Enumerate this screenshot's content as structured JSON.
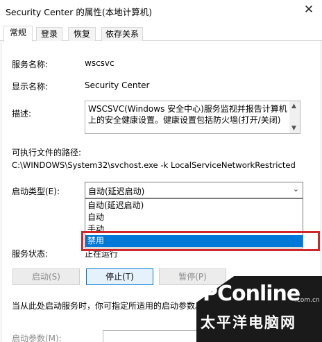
{
  "window": {
    "title": "Security Center 的属性(本地计算机)",
    "close_glyph": "✕"
  },
  "tabs": [
    "常规",
    "登录",
    "恢复",
    "依存关系"
  ],
  "general": {
    "service_name_label": "服务名称:",
    "service_name_value": "wscsvc",
    "display_name_label": "显示名称:",
    "display_name_value": "Security Center",
    "description_label": "描述:",
    "description_value": "WSCSVC(Windows 安全中心)服务监视并报告计算机上的安全健康设置。健康设置包括防火墙(打开/关闭)",
    "exe_path_label": "可执行文件的路径:",
    "exe_path_value": "C:\\WINDOWS\\System32\\svchost.exe -k LocalServiceNetworkRestricted",
    "startup_type_label": "启动类型(E):",
    "startup_type_selected": "自动(延迟启动)",
    "startup_options": [
      "自动(延迟启动)",
      "自动",
      "手动",
      "禁用"
    ],
    "highlighted_option": "禁用",
    "service_status_label": "服务状态:",
    "service_status_value": "正在运行",
    "buttons": {
      "start": "启动(S)",
      "stop": "停止(T)",
      "pause": "暂停(P)"
    },
    "hint": "当从此处启动服务时，你可指定所适用的启动参数。",
    "start_params_label": "启动参数(M):"
  },
  "watermark": {
    "brand": "PConline",
    "domain": ".com.cn",
    "cn": "太平洋电脑网"
  },
  "icons": {
    "dropdown": "chevron-down-icon",
    "close": "close-icon"
  },
  "colors": {
    "selection": "#0078d7",
    "highlight_frame": "#d0252b"
  }
}
